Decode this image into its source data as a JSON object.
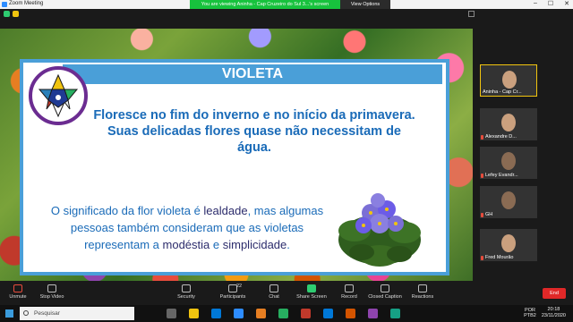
{
  "window": {
    "title": "Zoom Meeting",
    "viewing_banner": "You are viewing Aninha - Cap Cruzeiro do Sul 3...'s screen",
    "view_options_label": "View Options",
    "controls": [
      "–",
      "☐",
      "✕"
    ]
  },
  "slide": {
    "title": "VIOLETA",
    "lead": "Floresce no fim do inverno e no início da primavera. Suas delicadas flores quase não necessitam de água.",
    "body_parts": [
      "O significado da flor violeta é ",
      "lealdade",
      ", mas algumas pessoas também consideram que as violetas representam a ",
      "modéstia",
      " e ",
      "simplicidade",
      "."
    ]
  },
  "participants": [
    {
      "name": "Aninha - Cap Cr..."
    },
    {
      "name": "Alexandre D..."
    },
    {
      "name": "Lefey Evandr..."
    },
    {
      "name": "GH"
    },
    {
      "name": "Fred Mourão"
    }
  ],
  "toolbar": {
    "unmute": "Unmute",
    "stop_video": "Stop Video",
    "security": "Security",
    "participants": "Participants",
    "participant_count": "22",
    "chat": "Chat",
    "share_screen": "Share Screen",
    "record": "Record",
    "closed_caption": "Closed Caption",
    "reactions": "Reactions",
    "end": "End"
  },
  "taskbar": {
    "search_placeholder": "Pesquisar",
    "lang_top": "POR",
    "lang_bottom": "PTB2",
    "time": "20:18",
    "date": "23/11/2020"
  },
  "colors": {
    "accent_blue": "#4a9fd8",
    "text_blue": "#1a6bb8",
    "banner_green": "#17c23d",
    "end_red": "#e02828"
  }
}
